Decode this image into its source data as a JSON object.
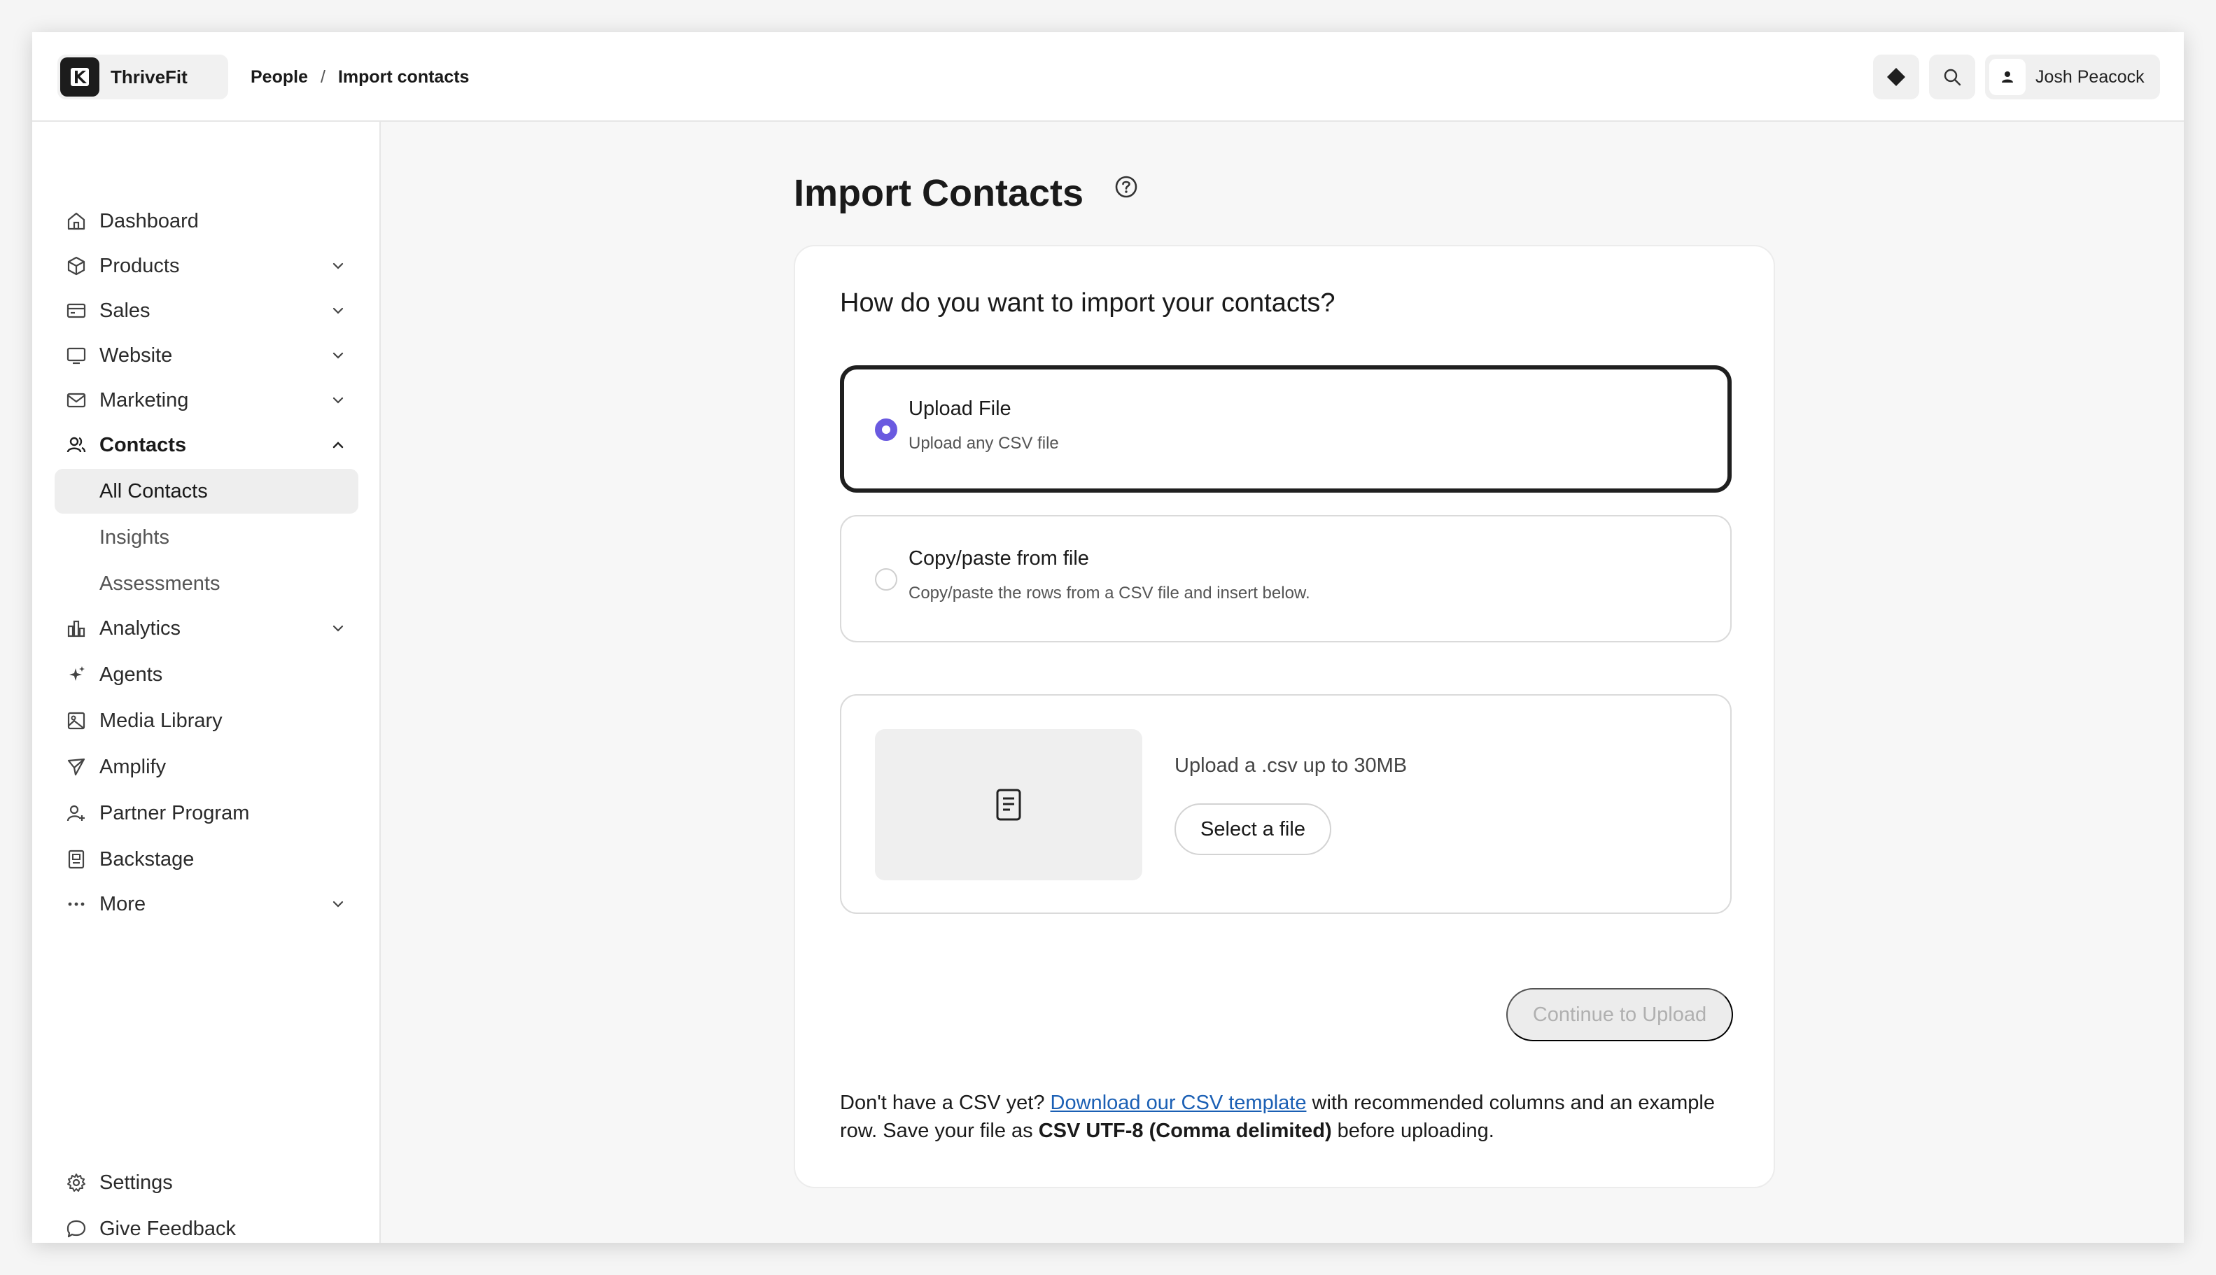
{
  "app": {
    "name": "ThriveFit"
  },
  "breadcrumb": {
    "items": [
      "People",
      "Import contacts"
    ],
    "separator": "/"
  },
  "header": {
    "user_name": "Josh Peacock",
    "icons": [
      "diamond-icon",
      "search-icon",
      "user-icon"
    ]
  },
  "sidebar": {
    "items": [
      {
        "label": "Dashboard",
        "icon": "home-icon",
        "expandable": false
      },
      {
        "label": "Products",
        "icon": "box-icon",
        "expandable": true
      },
      {
        "label": "Sales",
        "icon": "credit-card-icon",
        "expandable": true
      },
      {
        "label": "Website",
        "icon": "monitor-icon",
        "expandable": true
      },
      {
        "label": "Marketing",
        "icon": "mail-icon",
        "expandable": true
      },
      {
        "label": "Contacts",
        "icon": "users-icon",
        "expandable": true,
        "expanded": true
      },
      {
        "label": "Analytics",
        "icon": "bar-chart-icon",
        "expandable": true
      },
      {
        "label": "Agents",
        "icon": "sparkle-icon",
        "expandable": false
      },
      {
        "label": "Media Library",
        "icon": "image-icon",
        "expandable": false
      },
      {
        "label": "Amplify",
        "icon": "send-icon",
        "expandable": false
      },
      {
        "label": "Partner Program",
        "icon": "user-plus-icon",
        "expandable": false
      },
      {
        "label": "Backstage",
        "icon": "badge-icon",
        "expandable": false
      },
      {
        "label": "More",
        "icon": "dots-icon",
        "expandable": true
      }
    ],
    "contacts_subitems": [
      {
        "label": "All Contacts",
        "active": true
      },
      {
        "label": "Insights",
        "active": false
      },
      {
        "label": "Assessments",
        "active": false
      }
    ],
    "bottom_items": [
      {
        "label": "Settings",
        "icon": "gear-icon"
      },
      {
        "label": "Give Feedback",
        "icon": "chat-icon"
      }
    ]
  },
  "main": {
    "title": "Import Contacts",
    "question": "How do you want to import your contacts?",
    "options": [
      {
        "title": "Upload File",
        "description": "Upload any CSV file",
        "selected": true
      },
      {
        "title": "Copy/paste from file",
        "description": "Copy/paste the rows from a CSV file and insert below.",
        "selected": false
      }
    ],
    "upload": {
      "hint": "Upload a .csv up to 30MB",
      "button": "Select a file"
    },
    "continue_button": "Continue to Upload",
    "continue_enabled": false,
    "footer": {
      "prefix": "Don't have a CSV yet? ",
      "link": "Download our CSV template",
      "middle": " with recommended columns and an example row. Save your file as ",
      "bold": "CSV UTF-8 (Comma delimited)",
      "suffix": " before uploading."
    }
  },
  "colors": {
    "accent": "#6a5ae0",
    "link": "#1a5fb4",
    "selected_border": "#1f1f1f"
  }
}
